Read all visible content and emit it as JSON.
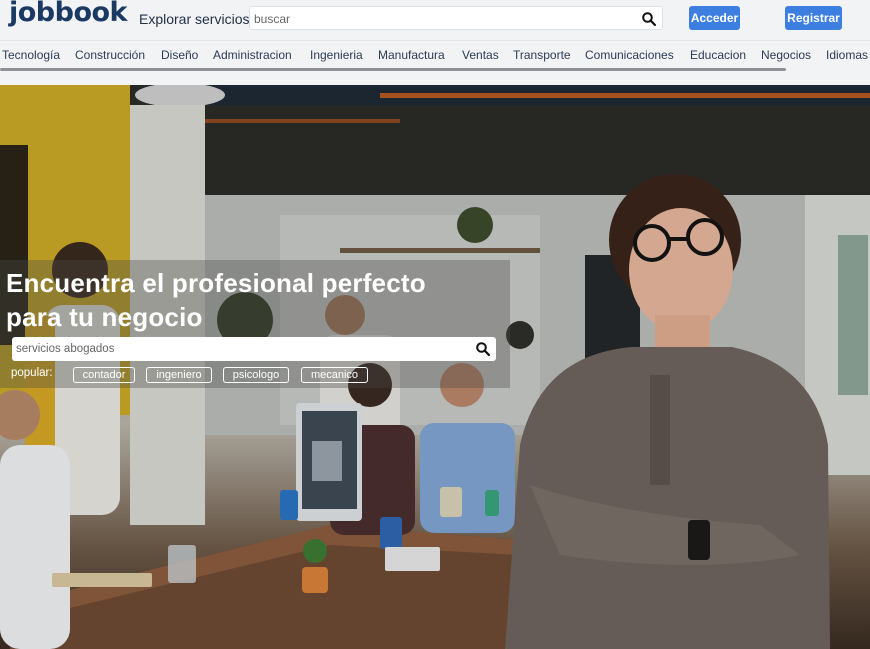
{
  "header": {
    "logo": "jobbook",
    "explore": "Explorar servicios",
    "search_placeholder": "buscar",
    "login_label": "Acceder",
    "register_label": "Registrar"
  },
  "categories": [
    "Tecnología",
    "Construcción",
    "Diseño",
    "Administracion",
    "Ingenieria",
    "Manufactura",
    "Ventas",
    "Transporte",
    "Comunicaciones",
    "Educacion",
    "Negocios",
    "Idiomas"
  ],
  "hero": {
    "title_line1": "Encuentra el profesional perfecto",
    "title_line2": "para tu negocio",
    "search_placeholder": "servicios abogados",
    "popular_label": "popular:",
    "popular_tags": [
      "contador",
      "ingeniero",
      "psicologo",
      "mecanico"
    ]
  },
  "colors": {
    "brand": "#1b3a63",
    "button": "#3d7fe0",
    "header_bg": "#f2f3f5"
  },
  "icons": [
    "search-icon"
  ]
}
